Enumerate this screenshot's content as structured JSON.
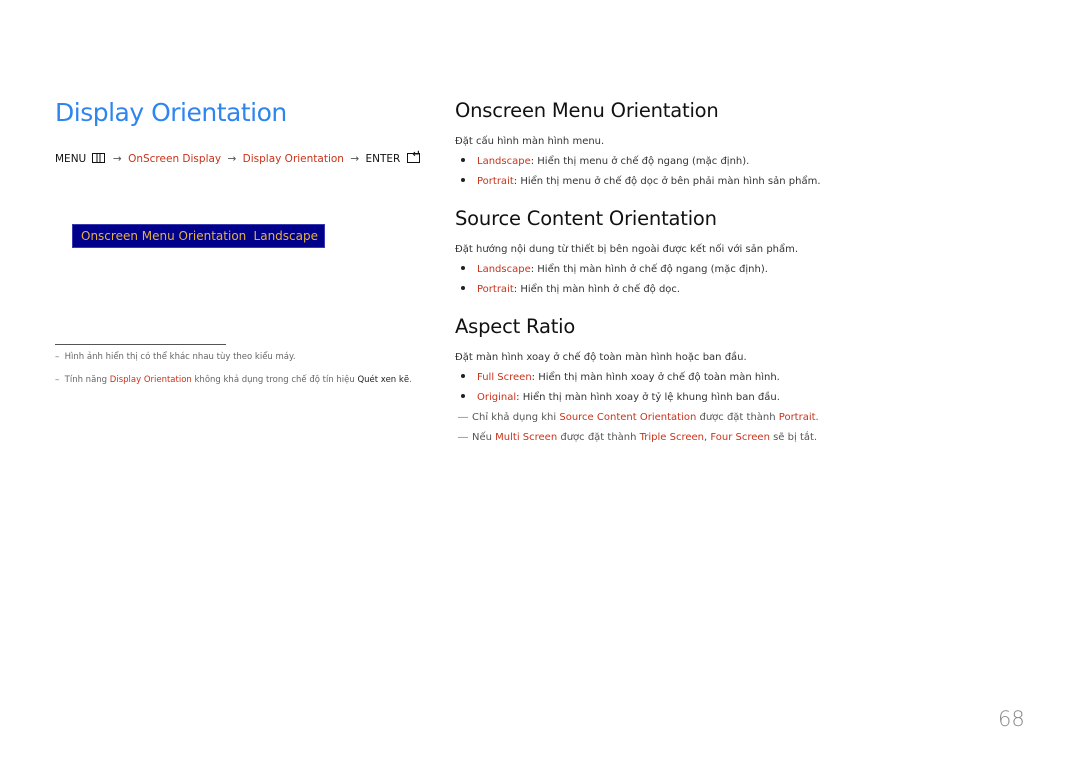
{
  "left": {
    "title": "Display Orientation",
    "path": {
      "menu": "MENU",
      "menu_icon": "menu-grid-icon",
      "arrow": "→",
      "step1": "OnScreen Display",
      "step2": "Display Orientation",
      "enter": "ENTER",
      "enter_icon": "enter-icon"
    },
    "osd": {
      "label": "Onscreen Menu Orientation",
      "value": "Landscape"
    },
    "notes": [
      {
        "dash": "–",
        "text": "Hình ảnh hiển thị có thể khác nhau tùy theo kiểu máy."
      },
      {
        "dash": "–",
        "pre": "Tính năng ",
        "highlight": "Display Orientation",
        "mid": " không khả dụng trong chế độ tín hiệu ",
        "dark": "Quét xen kẽ",
        "post": "."
      }
    ]
  },
  "sections": [
    {
      "heading": "Onscreen Menu Orientation",
      "desc": "Đặt cấu hình màn hình menu.",
      "items": [
        {
          "term": "Landscape",
          "text": ": Hiển thị menu ở chế độ ngang (mặc định)."
        },
        {
          "term": "Portrait",
          "text": ": Hiển thị menu ở chế độ dọc ở bên phải màn hình sản phẩm."
        }
      ]
    },
    {
      "heading": "Source Content Orientation",
      "desc": "Đặt hướng nội dung từ thiết bị bên ngoài được kết nối với sản phẩm.",
      "items": [
        {
          "term": "Landscape",
          "text": ": Hiển thị màn hình ở chế độ ngang (mặc định)."
        },
        {
          "term": "Portrait",
          "text": ": Hiển thị màn hình ở chế độ dọc."
        }
      ]
    },
    {
      "heading": "Aspect Ratio",
      "desc": "Đặt màn hình xoay ở chế độ toàn màn hình hoặc ban đầu.",
      "items": [
        {
          "term": "Full Screen",
          "text": ": Hiển thị màn hình xoay ở chế độ toàn màn hình."
        },
        {
          "term": "Original",
          "text": ": Hiển thị màn hình xoay ở tỷ lệ khung hình ban đầu."
        }
      ],
      "subnotes": [
        {
          "dash": "―",
          "a": "Chỉ khả dụng khi ",
          "r1": "Source Content Orientation",
          "b": " được đặt thành ",
          "r2": "Portrait",
          "c": "."
        },
        {
          "dash": "―",
          "a": "Nếu ",
          "r1": "Multi Screen",
          "b": " được đặt thành ",
          "r2": "Triple Screen",
          "c": ", ",
          "r3": "Four Screen",
          "d": " sẽ bị tắt."
        }
      ]
    }
  ],
  "page_number": "68",
  "colors": {
    "title_blue": "#2f85f0",
    "highlight_red": "#c8331b",
    "osd_bg": "#00008a",
    "osd_text": "#e6b23a"
  }
}
